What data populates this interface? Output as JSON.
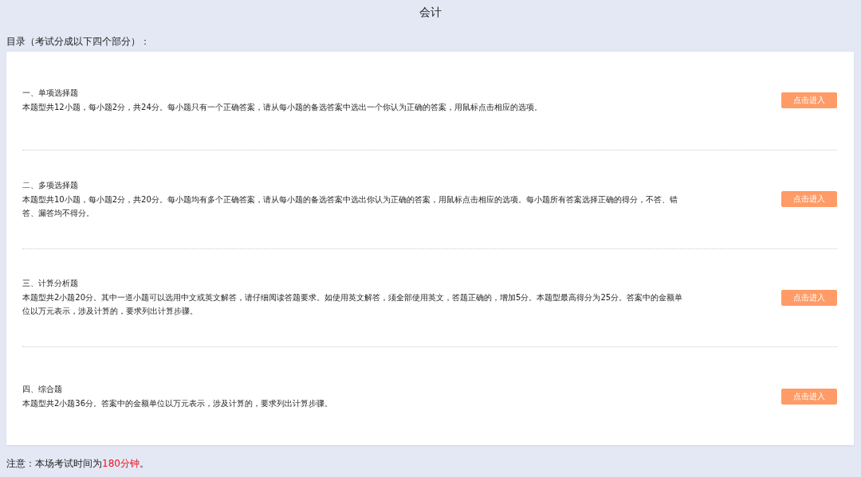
{
  "title": "会计",
  "toc_heading": "目录（考试分成以下四个部分）：",
  "sections": [
    {
      "title": "一、单项选择题",
      "description": "本题型共12小题，每小题2分，共24分。每小题只有一个正确答案，请从每小题的备选答案中选出一个你认为正确的答案，用鼠标点击相应的选项。",
      "button": "点击进入"
    },
    {
      "title": "二、多项选择题",
      "description": "本题型共10小题，每小题2分，共20分。每小题均有多个正确答案，请从每小题的备选答案中选出你认为正确的答案，用鼠标点击相应的选项。每小题所有答案选择正确的得分，不答、错答、漏答均不得分。",
      "button": "点击进入"
    },
    {
      "title": "三、计算分析题",
      "description": "本题型共2小题20分。其中一道小题可以选用中文或英文解答，请仔细阅读答题要求。如使用英文解答，须全部使用英文，答题正确的，增加5分。本题型最高得分为25分。答案中的金额单位以万元表示，涉及计算的，要求列出计算步骤。",
      "button": "点击进入"
    },
    {
      "title": "四、综合题",
      "description": "本题型共2小题36分。答案中的金额单位以万元表示，涉及计算的，要求列出计算步骤。",
      "button": "点击进入"
    }
  ],
  "notice": {
    "prefix": "注意：本场考试时间为",
    "highlight": "180分钟",
    "suffix": "。"
  }
}
